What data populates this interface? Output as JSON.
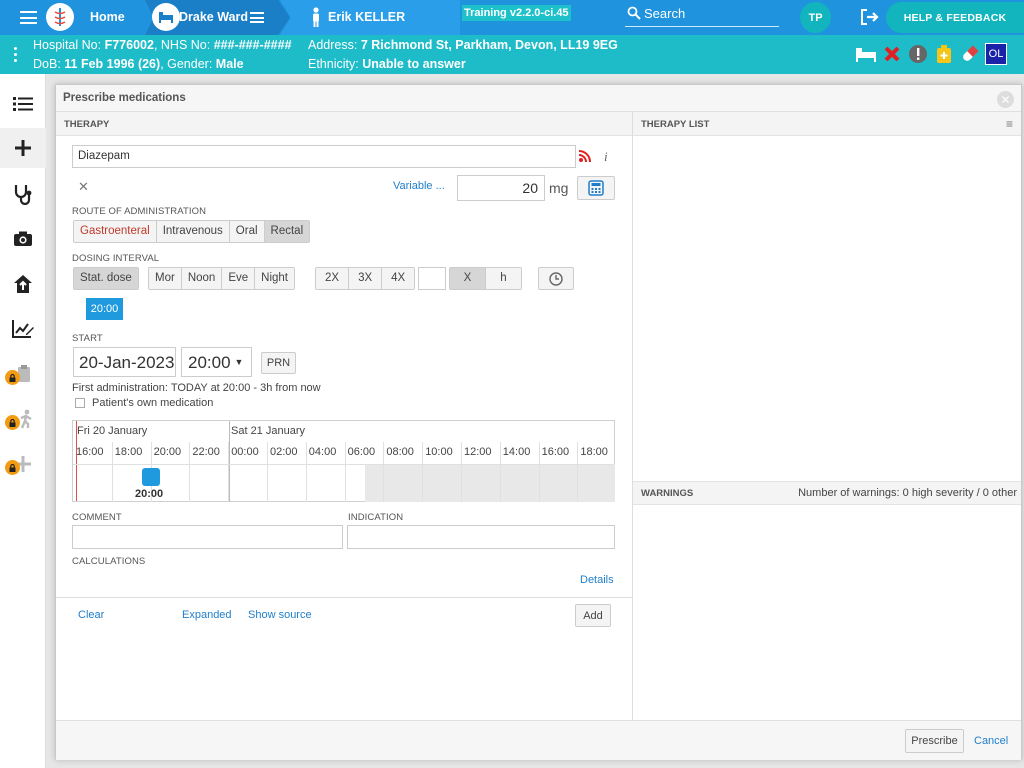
{
  "topbar": {
    "home": "Home",
    "ward": "Drake Ward",
    "patient": "Erik KELLER",
    "training": "Training v2.2.0-ci.45",
    "search": "Search",
    "avatar": "TP",
    "help": "HELP & FEEDBACK"
  },
  "patient": {
    "hospital_label": "Hospital No:",
    "hospital_no": "F776002",
    "nhs_label": ", NHS No:",
    "nhs_no": "###-###-####",
    "dob_label": "DoB:",
    "dob": "11 Feb 1996 (26)",
    "gender_label": ", Gender:",
    "gender": "Male",
    "address_label": "Address:",
    "address": "7 Richmond St, Parkham, Devon, LL19 9EG",
    "ethnicity_label": "Ethnicity:",
    "ethnicity": "Unable to answer",
    "badge_ol": "OL"
  },
  "dialog": {
    "title": "Prescribe medications",
    "therapy_header": "THERAPY",
    "therapy_list_header": "THERAPY LIST",
    "warnings_header": "WARNINGS",
    "warnings_summary": "Number of warnings: 0 high severity / 0 other",
    "medication": "Diazepam",
    "variable_link": "Variable ...",
    "dose_value": "20",
    "dose_unit": "mg",
    "route_label": "ROUTE OF ADMINISTRATION",
    "routes": [
      "Gastroenteral",
      "Intravenous",
      "Oral",
      "Rectal"
    ],
    "dosing_label": "DOSING INTERVAL",
    "stat_dose": "Stat. dose",
    "times_of_day": [
      "Mor",
      "Noon",
      "Eve",
      "Night"
    ],
    "frequency": [
      "2X",
      "3X",
      "4X"
    ],
    "interval_units": [
      "X",
      "h"
    ],
    "tooltip_time": "20:00",
    "start_label": "START",
    "start_date": "20-Jan-2023",
    "start_time": "20:00",
    "prn": "PRN",
    "first_admin": "First administration: TODAY at 20:00 - 3h from now",
    "own_med": "Patient's own medication",
    "timeline": {
      "day1": "Fri 20 January",
      "day2": "Sat 21 January",
      "hours": [
        "16:00",
        "18:00",
        "20:00",
        "22:00",
        "00:00",
        "02:00",
        "04:00",
        "06:00",
        "08:00",
        "10:00",
        "12:00",
        "14:00",
        "16:00",
        "18:00"
      ],
      "marker_label": "20:00"
    },
    "comment_label": "COMMENT",
    "indication_label": "INDICATION",
    "calculations_label": "CALCULATIONS",
    "details_link": "Details",
    "clear_link": "Clear",
    "expanded_link": "Expanded",
    "show_source_link": "Show source",
    "add_button": "Add",
    "prescribe_button": "Prescribe",
    "cancel_link": "Cancel"
  },
  "colors": {
    "topbar": "#1f93de",
    "patientbar": "#1ebcc8",
    "accent": "#12b5bd",
    "link": "#1f7ecb"
  }
}
